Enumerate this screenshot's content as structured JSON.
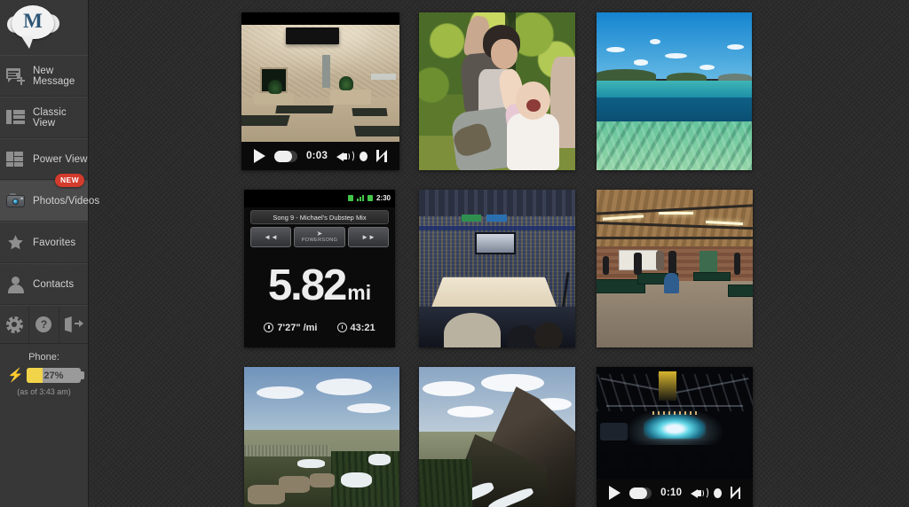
{
  "app": {
    "logo_letter": "M",
    "logo_name": "mightytext-cloud-logo"
  },
  "sidebar": {
    "items": [
      {
        "label": "New Message",
        "icon": "new-message-icon",
        "active": false,
        "badge": null
      },
      {
        "label": "Classic View",
        "icon": "classic-view-icon",
        "active": false,
        "badge": null
      },
      {
        "label": "Power View",
        "icon": "power-view-icon",
        "active": false,
        "badge": null
      },
      {
        "label": "Photos/Videos",
        "icon": "camera-icon",
        "active": true,
        "badge": "NEW"
      },
      {
        "label": "Favorites",
        "icon": "star-icon",
        "active": false,
        "badge": null
      },
      {
        "label": "Contacts",
        "icon": "contacts-icon",
        "active": false,
        "badge": null
      }
    ],
    "actions": [
      {
        "name": "settings-button",
        "icon": "gear-icon"
      },
      {
        "name": "help-button",
        "icon": "question-mark-icon"
      },
      {
        "name": "logout-button",
        "icon": "logout-icon"
      }
    ],
    "phone": {
      "title": "Phone:",
      "battery_percent_label": "27%",
      "battery_percent_value": 27,
      "timestamp": "(as of 3:43 am)",
      "charging": true,
      "fill_color": "#f2d44a",
      "bolt_color": "#2f6fd0"
    },
    "badge_color": "#d33b2c"
  },
  "gallery": {
    "items": [
      {
        "name": "video-room-interior",
        "type": "video",
        "description": "Interior room with textured stone walls, wall-mounted TV, benches and potted plants",
        "controls": {
          "time": "0:03",
          "play": "play-button",
          "volume": "volume-icon",
          "fullscreen": "fullscreen-icon"
        }
      },
      {
        "name": "photo-mother-and-baby",
        "type": "photo",
        "description": "Woman with short dark hair laughing with a baby outdoors under green trees"
      },
      {
        "name": "photo-tropical-beach",
        "type": "photo",
        "description": "Turquoise clear sea with distant green islands under a blue sky with small clouds"
      },
      {
        "name": "photo-running-app",
        "type": "photo",
        "description": "Phone screenshot of a running tracker app",
        "screen": {
          "status_time": "2:30",
          "song": "Song 9 - Michael's Dubstep Mix",
          "song_title": "Song 9",
          "song_artist": "Michael's Dubstep Mix",
          "prev_label": "◄◄",
          "next_label": "►►",
          "powersong_label": "POWERSONG",
          "distance": "5.82",
          "distance_unit": "mi",
          "pace": "7'27\" /mi",
          "duration": "43:21"
        }
      },
      {
        "name": "photo-basketball-arena",
        "type": "photo",
        "description": "Packed basketball arena seen from upper deck with scoreboard above the court"
      },
      {
        "name": "photo-ping-pong-hall",
        "type": "photo",
        "description": "Warehouse room with brick walls, wooden trusses and several ping pong tables"
      },
      {
        "name": "photo-valley-overlook",
        "type": "photo",
        "description": "Overlook of a wide valley with rocky foreground and patches of snow"
      },
      {
        "name": "photo-mountain-ridge",
        "type": "photo",
        "description": "Steep rocky mountain ridge with snow and pine trees above a plain"
      },
      {
        "name": "video-concert",
        "type": "video",
        "description": "Night concert under an open pavilion with a brightly lit stage and crowd silhouettes",
        "controls": {
          "time": "0:10",
          "play": "play-button",
          "volume": "volume-icon",
          "fullscreen": "fullscreen-icon"
        }
      }
    ]
  }
}
